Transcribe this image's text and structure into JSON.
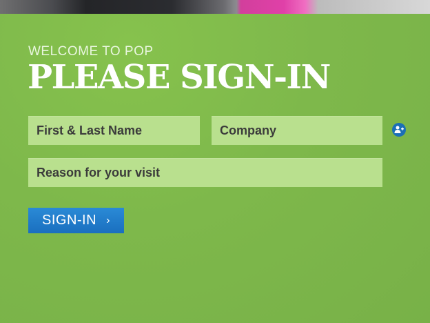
{
  "header": {
    "welcome_text": "WELCOME TO POP",
    "title": "PLEASE SIGN-IN"
  },
  "form": {
    "name_placeholder": "First & Last Name",
    "company_placeholder": "Company",
    "reason_placeholder": "Reason for your visit",
    "submit_label": "SIGN-IN",
    "submit_chevron": "›",
    "icon": "add-user-icon"
  },
  "colors": {
    "background": "#7db64a",
    "field": "#b9e08e",
    "button": "#1f7ac8"
  }
}
